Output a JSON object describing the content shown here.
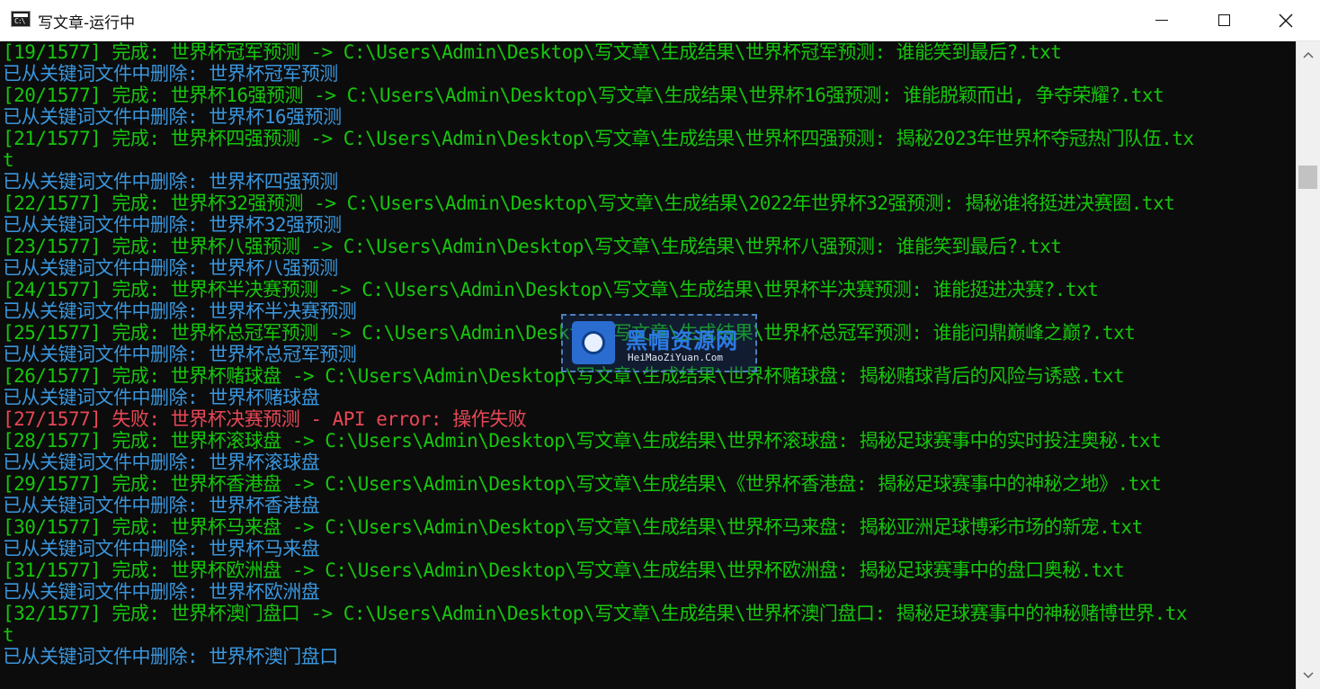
{
  "window": {
    "title": "写文章-运行中",
    "icon_label": "C:\\"
  },
  "console": {
    "lines": [
      {
        "text": "[19/1577] 完成: 世界杯冠军预测 -> C:\\Users\\Admin\\Desktop\\写文章\\生成结果\\世界杯冠军预测: 谁能笑到最后?.txt",
        "color": "#16c60c"
      },
      {
        "text": "已从关键词文件中删除: 世界杯冠军预测",
        "color": "#3a96dd"
      },
      {
        "text": "[20/1577] 完成: 世界杯16强预测 -> C:\\Users\\Admin\\Desktop\\写文章\\生成结果\\世界杯16强预测: 谁能脱颖而出, 争夺荣耀?.txt",
        "color": "#16c60c"
      },
      {
        "text": "已从关键词文件中删除: 世界杯16强预测",
        "color": "#3a96dd"
      },
      {
        "text": "[21/1577] 完成: 世界杯四强预测 -> C:\\Users\\Admin\\Desktop\\写文章\\生成结果\\世界杯四强预测: 揭秘2023年世界杯夺冠热门队伍.tx",
        "color": "#16c60c"
      },
      {
        "text": "t",
        "color": "#16c60c"
      },
      {
        "text": "已从关键词文件中删除: 世界杯四强预测",
        "color": "#3a96dd"
      },
      {
        "text": "[22/1577] 完成: 世界杯32强预测 -> C:\\Users\\Admin\\Desktop\\写文章\\生成结果\\2022年世界杯32强预测: 揭秘谁将挺进决赛圈.txt",
        "color": "#16c60c"
      },
      {
        "text": "已从关键词文件中删除: 世界杯32强预测",
        "color": "#3a96dd"
      },
      {
        "text": "[23/1577] 完成: 世界杯八强预测 -> C:\\Users\\Admin\\Desktop\\写文章\\生成结果\\世界杯八强预测: 谁能笑到最后?.txt",
        "color": "#16c60c"
      },
      {
        "text": "已从关键词文件中删除: 世界杯八强预测",
        "color": "#3a96dd"
      },
      {
        "text": "[24/1577] 完成: 世界杯半决赛预测 -> C:\\Users\\Admin\\Desktop\\写文章\\生成结果\\世界杯半决赛预测: 谁能挺进决赛?.txt",
        "color": "#16c60c"
      },
      {
        "text": "已从关键词文件中删除: 世界杯半决赛预测",
        "color": "#3a96dd"
      },
      {
        "text": "[25/1577] 完成: 世界杯总冠军预测 -> C:\\Users\\Admin\\Desktop\\写文章\\生成结果\\世界杯总冠军预测: 谁能问鼎巅峰之巅?.txt",
        "color": "#16c60c"
      },
      {
        "text": "已从关键词文件中删除: 世界杯总冠军预测",
        "color": "#3a96dd"
      },
      {
        "text": "[26/1577] 完成: 世界杯赌球盘 -> C:\\Users\\Admin\\Desktop\\写文章\\生成结果\\世界杯赌球盘: 揭秘赌球背后的风险与诱惑.txt",
        "color": "#16c60c"
      },
      {
        "text": "已从关键词文件中删除: 世界杯赌球盘",
        "color": "#3a96dd"
      },
      {
        "text": "[27/1577] 失败: 世界杯决赛预测 - API error: 操作失败",
        "color": "#e74856"
      },
      {
        "text": "[28/1577] 完成: 世界杯滚球盘 -> C:\\Users\\Admin\\Desktop\\写文章\\生成结果\\世界杯滚球盘: 揭秘足球赛事中的实时投注奥秘.txt",
        "color": "#16c60c"
      },
      {
        "text": "已从关键词文件中删除: 世界杯滚球盘",
        "color": "#3a96dd"
      },
      {
        "text": "[29/1577] 完成: 世界杯香港盘 -> C:\\Users\\Admin\\Desktop\\写文章\\生成结果\\《世界杯香港盘: 揭秘足球赛事中的神秘之地》.txt",
        "color": "#16c60c"
      },
      {
        "text": "已从关键词文件中删除: 世界杯香港盘",
        "color": "#3a96dd"
      },
      {
        "text": "[30/1577] 完成: 世界杯马来盘 -> C:\\Users\\Admin\\Desktop\\写文章\\生成结果\\世界杯马来盘: 揭秘亚洲足球博彩市场的新宠.txt",
        "color": "#16c60c"
      },
      {
        "text": "已从关键词文件中删除: 世界杯马来盘",
        "color": "#3a96dd"
      },
      {
        "text": "[31/1577] 完成: 世界杯欧洲盘 -> C:\\Users\\Admin\\Desktop\\写文章\\生成结果\\世界杯欧洲盘: 揭秘足球赛事中的盘口奥秘.txt",
        "color": "#16c60c"
      },
      {
        "text": "已从关键词文件中删除: 世界杯欧洲盘",
        "color": "#3a96dd"
      },
      {
        "text": "[32/1577] 完成: 世界杯澳门盘口 -> C:\\Users\\Admin\\Desktop\\写文章\\生成结果\\世界杯澳门盘口: 揭秘足球赛事中的神秘赌博世界.tx",
        "color": "#16c60c"
      },
      {
        "text": "t",
        "color": "#16c60c"
      },
      {
        "text": "已从关键词文件中删除: 世界杯澳门盘口",
        "color": "#3a96dd"
      }
    ]
  },
  "watermark": {
    "title": "黑帽资源网",
    "subtitle": "HeiMaoZiYuan.Com"
  },
  "scrollbar": {
    "position_fraction": 0.17
  }
}
